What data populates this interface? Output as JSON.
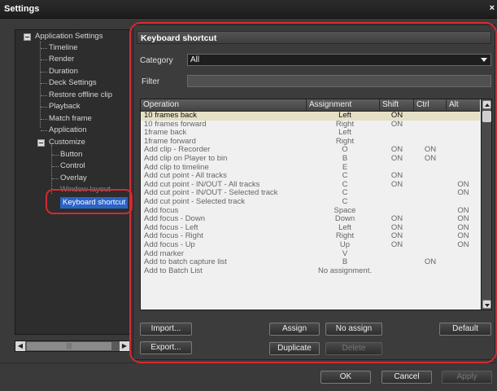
{
  "window": {
    "title": "Settings",
    "close_glyph": "×"
  },
  "tree": {
    "items": [
      {
        "label": "Application Settings",
        "level": 0,
        "expander": true
      },
      {
        "label": "Timeline",
        "level": 1
      },
      {
        "label": "Render",
        "level": 1
      },
      {
        "label": "Duration",
        "level": 1
      },
      {
        "label": "Deck Settings",
        "level": 1
      },
      {
        "label": "Restore offline clip",
        "level": 1
      },
      {
        "label": "Playback",
        "level": 1
      },
      {
        "label": "Match frame",
        "level": 1
      },
      {
        "label": "Application",
        "level": 1
      },
      {
        "label": "Customize",
        "level": 1,
        "expander": true
      },
      {
        "label": "Button",
        "level": 2
      },
      {
        "label": "Control",
        "level": 2
      },
      {
        "label": "Overlay",
        "level": 2
      },
      {
        "label": "Window layout",
        "level": 2
      },
      {
        "label": "Keyboard shortcut",
        "level": 2,
        "selected": true
      }
    ],
    "scroll_glyph": "|||"
  },
  "panel": {
    "title": "Keyboard shortcut",
    "category_label": "Category",
    "category_value": "All",
    "filter_label": "Filter",
    "filter_value": ""
  },
  "table": {
    "columns": [
      "Operation",
      "Assignment",
      "Shift",
      "Ctrl",
      "Alt"
    ],
    "rows": [
      {
        "op": "10 frames back",
        "as": "Left",
        "sh": "ON",
        "ct": "",
        "al": "",
        "selected": true
      },
      {
        "op": "10 frames forward",
        "as": "Right",
        "sh": "ON",
        "ct": "",
        "al": ""
      },
      {
        "op": "1frame back",
        "as": "Left",
        "sh": "",
        "ct": "",
        "al": ""
      },
      {
        "op": "1frame forward",
        "as": "Right",
        "sh": "",
        "ct": "",
        "al": ""
      },
      {
        "op": "Add clip - Recorder",
        "as": "O",
        "sh": "ON",
        "ct": "ON",
        "al": ""
      },
      {
        "op": "Add clip on Player to bin",
        "as": "B",
        "sh": "ON",
        "ct": "ON",
        "al": ""
      },
      {
        "op": "Add clip to timeline",
        "as": "E",
        "sh": "",
        "ct": "",
        "al": ""
      },
      {
        "op": "Add cut point - All tracks",
        "as": "C",
        "sh": "ON",
        "ct": "",
        "al": ""
      },
      {
        "op": "Add cut point - IN/OUT - All tracks",
        "as": "C",
        "sh": "ON",
        "ct": "",
        "al": "ON"
      },
      {
        "op": "Add cut point - IN/OUT - Selected track",
        "as": "C",
        "sh": "",
        "ct": "",
        "al": "ON"
      },
      {
        "op": "Add cut point - Selected track",
        "as": "C",
        "sh": "",
        "ct": "",
        "al": ""
      },
      {
        "op": "Add focus",
        "as": "Space",
        "sh": "",
        "ct": "",
        "al": "ON"
      },
      {
        "op": "Add focus - Down",
        "as": "Down",
        "sh": "ON",
        "ct": "",
        "al": "ON"
      },
      {
        "op": "Add focus - Left",
        "as": "Left",
        "sh": "ON",
        "ct": "",
        "al": "ON"
      },
      {
        "op": "Add focus - Right",
        "as": "Right",
        "sh": "ON",
        "ct": "",
        "al": "ON"
      },
      {
        "op": "Add focus - Up",
        "as": "Up",
        "sh": "ON",
        "ct": "",
        "al": "ON"
      },
      {
        "op": "Add marker",
        "as": "V",
        "sh": "",
        "ct": "",
        "al": ""
      },
      {
        "op": "Add to batch capture list",
        "as": "B",
        "sh": "",
        "ct": "ON",
        "al": ""
      },
      {
        "op": "Add to Batch List",
        "as": "No assignment.",
        "sh": "",
        "ct": "",
        "al": ""
      }
    ]
  },
  "buttons": {
    "import": "Import...",
    "export": "Export...",
    "assign": "Assign",
    "no_assign": "No assign",
    "duplicate": "Duplicate",
    "delete": "Delete",
    "default": "Default",
    "ok": "OK",
    "cancel": "Cancel",
    "apply": "Apply"
  },
  "colors": {
    "highlight": "#d32a33",
    "selection": "#2a63c6",
    "row_selected": "#e5e0c6"
  }
}
